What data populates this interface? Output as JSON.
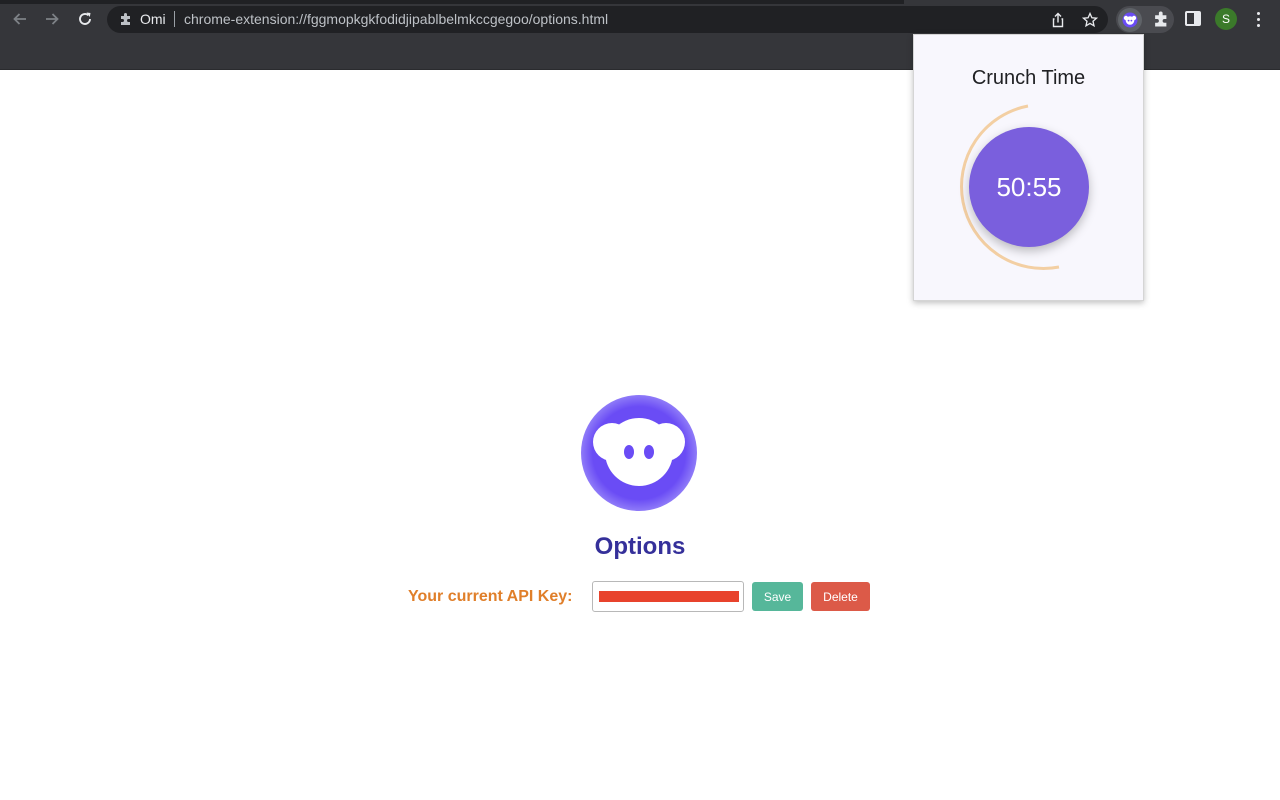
{
  "browser": {
    "nav": {
      "back_icon": "arrow-left-icon",
      "forward_icon": "arrow-right-icon",
      "reload_icon": "reload-icon"
    },
    "omnibox": {
      "site_label": "Omi",
      "url": "chrome-extension://fggmopkgkfodidjipablbelmkccgegoo/options.html",
      "share_icon": "share-icon",
      "bookmark_icon": "star-icon"
    },
    "extensions": {
      "omi_icon": "omi-extension-icon",
      "puzzle_icon": "extensions-puzzle-icon"
    },
    "side_panel_icon": "side-panel-icon",
    "profile_initial": "S",
    "menu_icon": "kebab-menu-icon"
  },
  "popup": {
    "title": "Crunch Time",
    "timer": "50:55",
    "arc_color": "#f3cfa3",
    "timer_color": "#7a5fdd"
  },
  "options_page": {
    "logo_icon": "omi-logo-icon",
    "title": "Options",
    "api_key_label": "Your current API Key:",
    "api_key_value_redacted": true,
    "save_label": "Save",
    "delete_label": "Delete",
    "colors": {
      "title": "#35309a",
      "label": "#e07f2a",
      "save": "#56b79a",
      "delete": "#dc5a48",
      "logo": "#6a4cf5"
    }
  }
}
